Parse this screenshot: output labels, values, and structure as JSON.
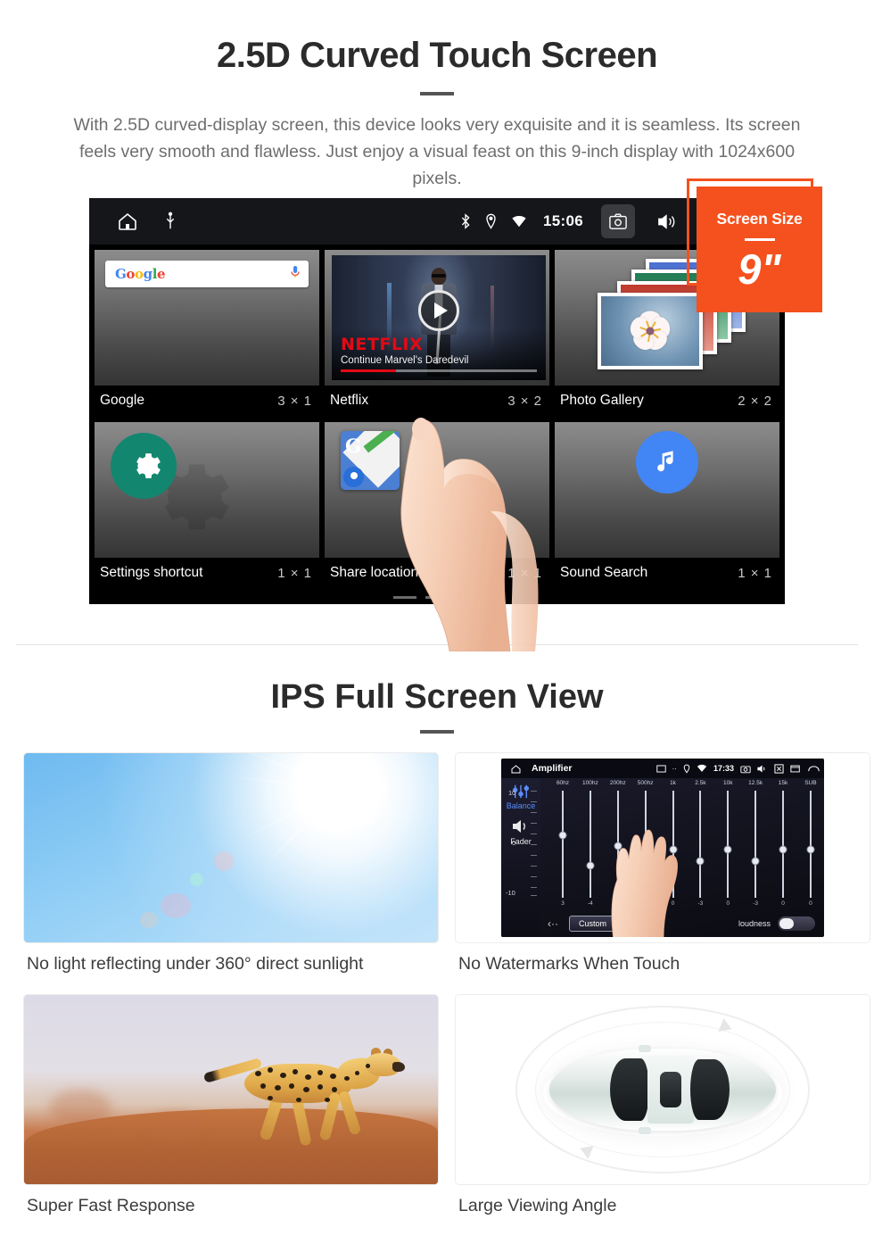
{
  "section1": {
    "title": "2.5D Curved Touch Screen",
    "description": "With 2.5D curved-display screen, this device looks very exquisite and it is seamless. Its screen feels very smooth and flawless. Just enjoy a visual feast on this 9-inch display with 1024x600 pixels."
  },
  "badge": {
    "label": "Screen Size",
    "value": "9\"",
    "color": "#f4511e"
  },
  "device": {
    "statusbar": {
      "time": "15:06",
      "left_icons": [
        "home-icon",
        "usb-icon"
      ],
      "right_icons": [
        "bluetooth-icon",
        "location-icon",
        "wifi-icon",
        "camera-icon",
        "volume-icon",
        "close-box-icon",
        "recents-icon"
      ]
    },
    "google_widget": {
      "logo_letters": [
        "G",
        "o",
        "o",
        "g",
        "l",
        "e"
      ],
      "mic_icon": "microphone-icon"
    },
    "netflix_widget": {
      "brand": "NETFLIX",
      "subtitle": "Continue Marvel's Daredevil",
      "progress_percent": 28
    },
    "widgets": [
      {
        "name": "Google",
        "size": "3 × 1"
      },
      {
        "name": "Netflix",
        "size": "3 × 2"
      },
      {
        "name": "Photo Gallery",
        "size": "2 × 2"
      },
      {
        "name": "Settings shortcut",
        "size": "1 × 1"
      },
      {
        "name": "Share location",
        "size": "1 × 1"
      },
      {
        "name": "Sound Search",
        "size": "1 × 1"
      }
    ],
    "page_dots": {
      "count": 3,
      "active_index": 2
    }
  },
  "section2": {
    "title": "IPS Full Screen View",
    "cards": [
      {
        "caption": "No light reflecting under 360° direct sunlight",
        "image": "sunlight-sky-photo"
      },
      {
        "caption": "No Watermarks When Touch",
        "image": "equalizer-screenshot"
      },
      {
        "caption": "Super Fast Response",
        "image": "running-cheetah-photo"
      },
      {
        "caption": "Large Viewing Angle",
        "image": "car-top-view-illustration"
      }
    ]
  },
  "equalizer": {
    "title": "Amplifier",
    "time": "17:33",
    "sidebar": [
      {
        "label": "Balance",
        "active": true
      },
      {
        "label": "Fader",
        "active": false
      }
    ],
    "scale": {
      "max": "10",
      "mid": "0",
      "min": "-10"
    },
    "bands": [
      {
        "freq": "60hz",
        "value": "3"
      },
      {
        "freq": "100hz",
        "value": "-4"
      },
      {
        "freq": "200hz",
        "value": "0"
      },
      {
        "freq": "500hz",
        "value": "0"
      },
      {
        "freq": "1k",
        "value": "0"
      },
      {
        "freq": "2.5k",
        "value": "-3"
      },
      {
        "freq": "10k",
        "value": "0"
      },
      {
        "freq": "12.5k",
        "value": "-3"
      },
      {
        "freq": "15k",
        "value": "0"
      },
      {
        "freq": "SUB",
        "value": "0"
      }
    ],
    "preset_button": "Custom",
    "loudness_label": "loudness",
    "loudness_on": false,
    "back_icon": "back-arrow-icon"
  }
}
